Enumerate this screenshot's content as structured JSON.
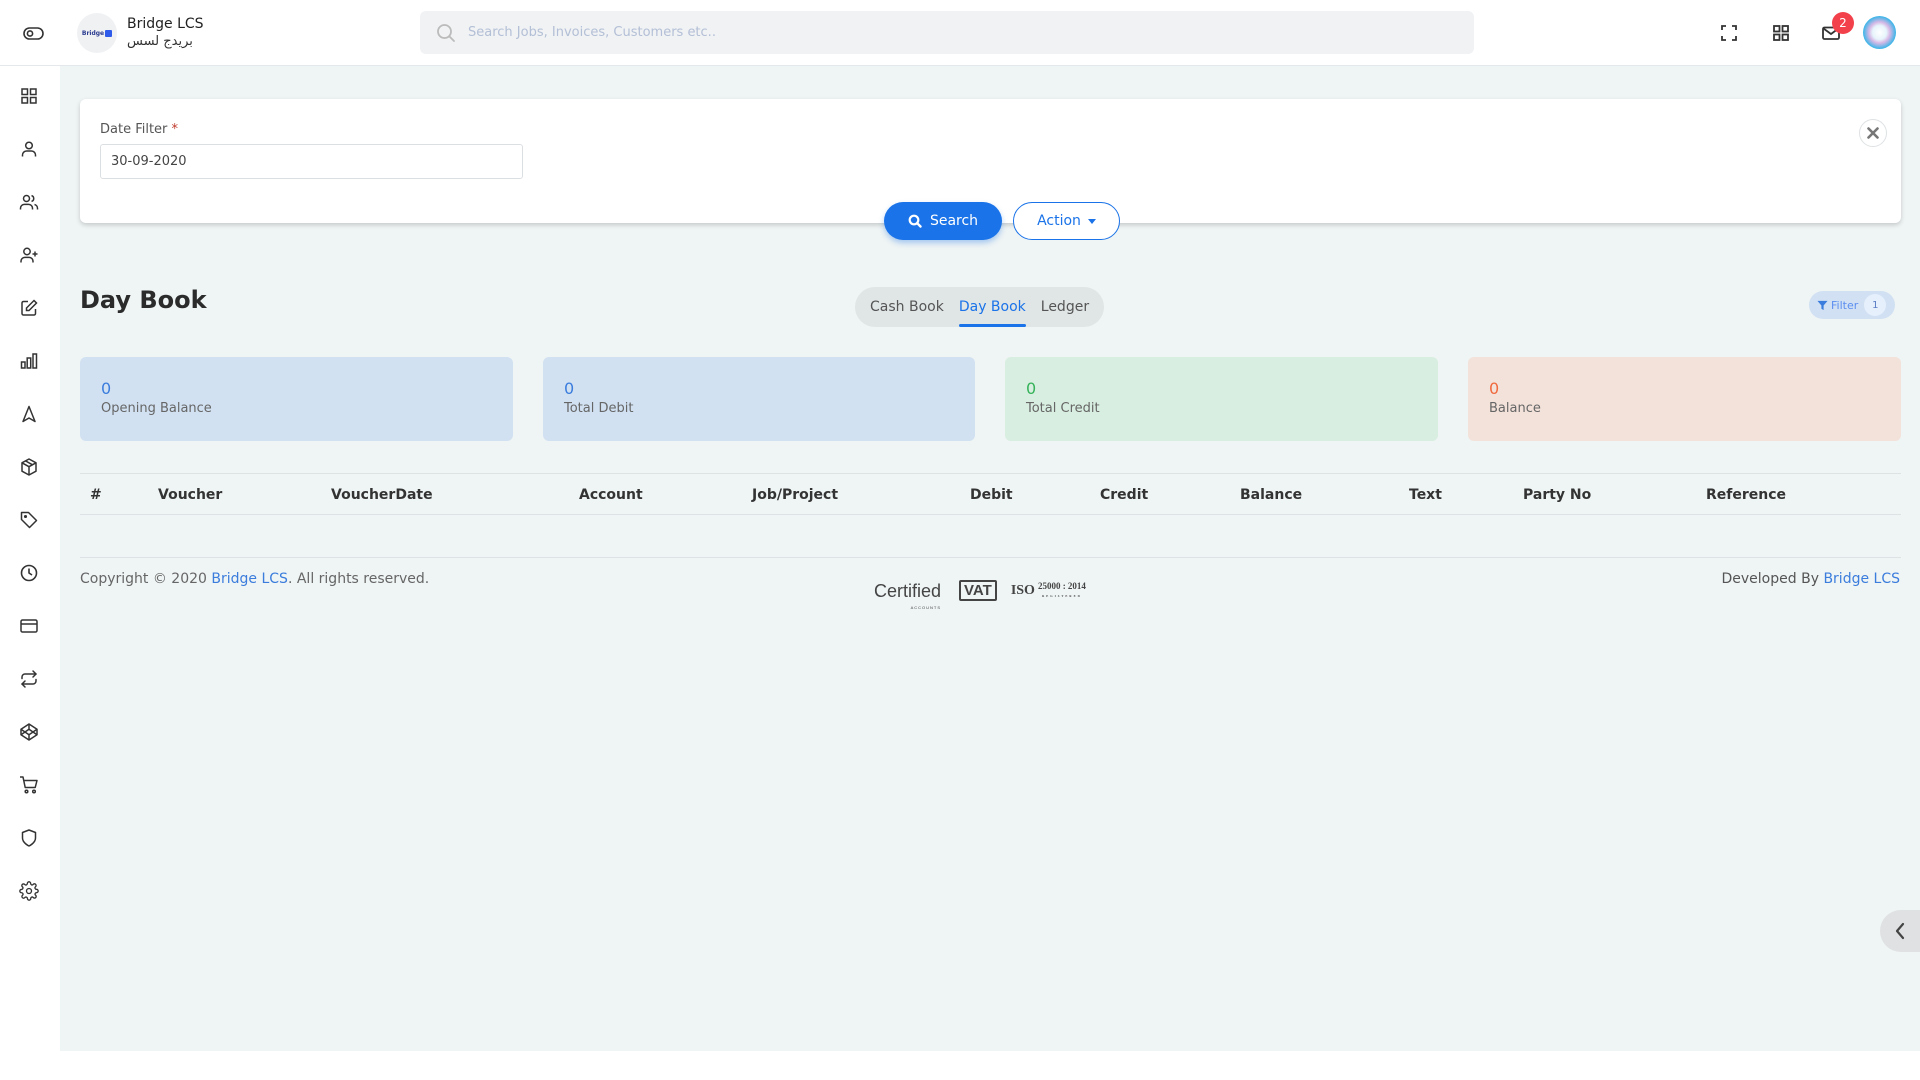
{
  "header": {
    "brand_name": "Bridge LCS",
    "brand_arabic": "بريدج لسس",
    "logo_text": "Bridge",
    "search_placeholder": "Search Jobs, Invoices, Customers etc..",
    "notification_count": "2",
    "icons": [
      "toggle-icon",
      "fullscreen-icon",
      "apps-grid-icon",
      "mail-icon",
      "avatar"
    ]
  },
  "sidebar": {
    "items": [
      {
        "name": "dashboard",
        "icon": "grid-icon"
      },
      {
        "name": "user",
        "icon": "user-icon"
      },
      {
        "name": "users",
        "icon": "users-icon"
      },
      {
        "name": "add-user",
        "icon": "user-plus-icon"
      },
      {
        "name": "edit",
        "icon": "edit-icon"
      },
      {
        "name": "reports",
        "icon": "bar-chart-icon"
      },
      {
        "name": "navigation",
        "icon": "navigation-icon"
      },
      {
        "name": "inventory",
        "icon": "box-icon"
      },
      {
        "name": "tags",
        "icon": "tag-icon"
      },
      {
        "name": "history",
        "icon": "clock-icon"
      },
      {
        "name": "payments",
        "icon": "credit-card-icon"
      },
      {
        "name": "transfers",
        "icon": "repeat-icon"
      },
      {
        "name": "codepen",
        "icon": "codepen-icon"
      },
      {
        "name": "sales",
        "icon": "cart-icon"
      },
      {
        "name": "security",
        "icon": "shield-icon"
      },
      {
        "name": "settings",
        "icon": "gear-icon"
      }
    ]
  },
  "filter": {
    "date_label": "Date Filter",
    "required_mark": "*",
    "date_value": "30-09-2020",
    "search_button": "Search",
    "action_button": "Action"
  },
  "page": {
    "title": "Day Book",
    "tabs": [
      {
        "label": "Cash Book",
        "active": false
      },
      {
        "label": "Day Book",
        "active": true
      },
      {
        "label": "Ledger",
        "active": false
      }
    ],
    "filter_pill_label": "Filter",
    "filter_pill_count": "1"
  },
  "stats": [
    {
      "value": "0",
      "label": "Opening Balance",
      "color": "#3b7ddd"
    },
    {
      "value": "0",
      "label": "Total Debit",
      "color": "#3b7ddd"
    },
    {
      "value": "0",
      "label": "Total Credit",
      "color": "#36b35a"
    },
    {
      "value": "0",
      "label": "Balance",
      "color": "#f06a3e"
    }
  ],
  "table": {
    "columns": [
      "#",
      "Voucher",
      "VoucherDate",
      "Account",
      "Job/Project",
      "Debit",
      "Credit",
      "Balance",
      "Text",
      "Party No",
      "Reference"
    ],
    "rows": []
  },
  "footer": {
    "copyright_prefix": "Copyright © 2020 ",
    "copyright_link": "Bridge LCS",
    "copyright_suffix": ". All rights reserved.",
    "cert_certified": "Certified",
    "cert_certified_sub": "ACCOUNTS",
    "cert_vat": "VAT",
    "cert_iso": "ISO",
    "cert_iso_num": "25000 : 2014",
    "cert_iso_sub": "REGISTERED",
    "developed_prefix": "Developed By ",
    "developed_link": "Bridge LCS"
  }
}
